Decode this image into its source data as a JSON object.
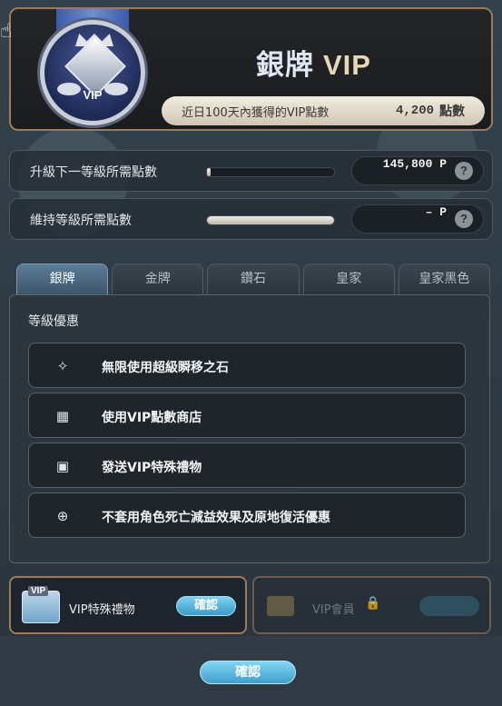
{
  "header": {
    "title_main": "銀牌",
    "title_vip": "VIP",
    "medal_text": "VIP",
    "points_label": "近日100天內獲得的VIP點數",
    "points_value": "4,200",
    "points_unit": "點數"
  },
  "upgrade": {
    "label": "升級下一等級所需點數",
    "value": "145,800 P",
    "progress": 0.03
  },
  "maintain": {
    "label": "維持等級所需點數",
    "value": "– P",
    "progress": 1.0
  },
  "tabs": [
    "銀牌",
    "金牌",
    "鑽石",
    "皇家",
    "皇家黑色"
  ],
  "benefits": {
    "heading": "等級優惠",
    "items": [
      {
        "icon": "teleport-stone-icon",
        "text": "無限使用超級瞬移之石"
      },
      {
        "icon": "shop-icon",
        "text": "使用VIP點數商店"
      },
      {
        "icon": "gift-icon",
        "text": "發送VIP特殊禮物"
      },
      {
        "icon": "revive-icon",
        "text": "不套用角色死亡減益效果及原地復活優惠"
      }
    ]
  },
  "gift_panel": {
    "label": "VIP特殊禮物",
    "button": "確認"
  },
  "member_panel": {
    "label": "VIP會員"
  },
  "confirm_button": "確認"
}
